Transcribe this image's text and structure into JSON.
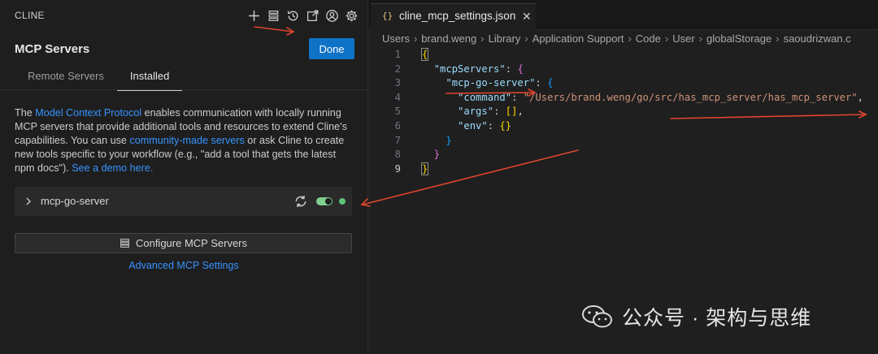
{
  "app": {
    "title": "CLINE",
    "icons": [
      "plus-icon",
      "stack-icon",
      "history-icon",
      "external-link-icon",
      "account-icon",
      "gear-icon"
    ]
  },
  "mcp": {
    "title": "MCP Servers",
    "done_label": "Done",
    "tabs": [
      {
        "label": "Remote Servers",
        "active": false
      },
      {
        "label": "Installed",
        "active": true
      }
    ],
    "description": {
      "t1": "The ",
      "link1": "Model Context Protocol",
      "t2": " enables communication with locally running MCP servers that provide additional tools and resources to extend Cline's capabilities. You can use ",
      "link2": "community-made servers",
      "t3": " or ask Cline to create new tools specific to your workflow (e.g., \"add a tool that gets the latest npm docs\"). ",
      "link3": "See a demo here."
    },
    "server": {
      "name": "mcp-go-server",
      "enabled": true,
      "status_color": "#5ec47a"
    },
    "configure_label": "Configure MCP Servers",
    "advanced_label": "Advanced MCP Settings"
  },
  "editor": {
    "tab_icon_text": "{}",
    "tab_label": "cline_mcp_settings.json",
    "breadcrumb": [
      "Users",
      "brand.weng",
      "Library",
      "Application Support",
      "Code",
      "User",
      "globalStorage",
      "saoudrizwan.c"
    ],
    "line_numbers": [
      "1",
      "2",
      "3",
      "4",
      "5",
      "6",
      "7",
      "8",
      "9"
    ],
    "code": {
      "mcpServers": "\"mcpServers\"",
      "server_key": "\"mcp-go-server\"",
      "command_key": "\"command\"",
      "command_value": "\"/Users/brand.weng/go/src/has_mcp_server/has_mcp_server\"",
      "args_key": "\"args\"",
      "env_key": "\"env\""
    }
  },
  "watermark": {
    "text": "公众号 · 架构与思维"
  },
  "colors": {
    "accent": "#0e72c7",
    "link": "#3794ff",
    "annotation_arrow": "#e0452e"
  }
}
